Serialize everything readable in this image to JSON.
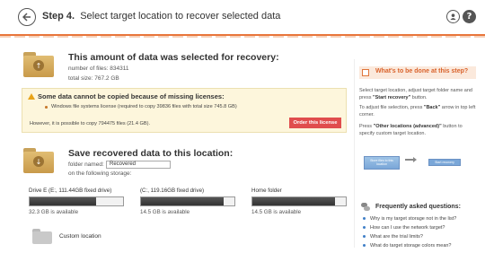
{
  "header": {
    "step_label": "Step 4.",
    "title": "Select target location to recover selected data",
    "help_label": "?"
  },
  "selection": {
    "title": "This amount of data was selected for recovery:",
    "files_line": "number of files: 834311",
    "size_line": "total size: 767.2 GB"
  },
  "warning": {
    "title": "Some data cannot be copied because of missing licenses:",
    "item": "Windows file systems license (required to copy 39836 files with total size 745.8 GB)",
    "footer": "However, it is possible to copy 794475 files (21.4 GB).",
    "order_button": "Order this license"
  },
  "save": {
    "title": "Save recovered data to this location:",
    "folder_label": "folder named:",
    "folder_value": "Recovered",
    "storage_label": "on the following storage:"
  },
  "drives": [
    {
      "label": "Drive E (E:, 111.44GB fixed drive)",
      "available": "32.3 GB is available",
      "used_fraction": 0.71
    },
    {
      "label": "(C:, 119.16GB fixed drive)",
      "available": "14.5 GB is available",
      "used_fraction": 0.88
    },
    {
      "label": "Home folder",
      "available": "14.5 GB is available",
      "used_fraction": 0.88
    }
  ],
  "custom_location": "Custom location",
  "help_panel": {
    "title": "What's to be done at this step?",
    "p1_a": "Select target location, adjust target folder name and press ",
    "p1_b": "\"Start recovery\"",
    "p1_c": " button.",
    "p2_a": "To adjust file selection, press ",
    "p2_b": "\"Back\"",
    "p2_c": " arrow in top left corner.",
    "p3_a": "Press ",
    "p3_b": "\"Other locations (advanced)\"",
    "p3_c": " button to specify custom target location.",
    "mini_left": "Store files to this location",
    "mini_right": "Start recovery"
  },
  "faq": {
    "title": "Frequently asked questions:",
    "items": [
      "Why is my target storage not in the list?",
      "How can I use the network target?",
      "What are the trial limits?",
      "What do target storage colors mean?"
    ]
  },
  "colors": {
    "accent": "#e8753a",
    "order_button": "#e04d4d",
    "link_dot": "#3f7fc7"
  }
}
